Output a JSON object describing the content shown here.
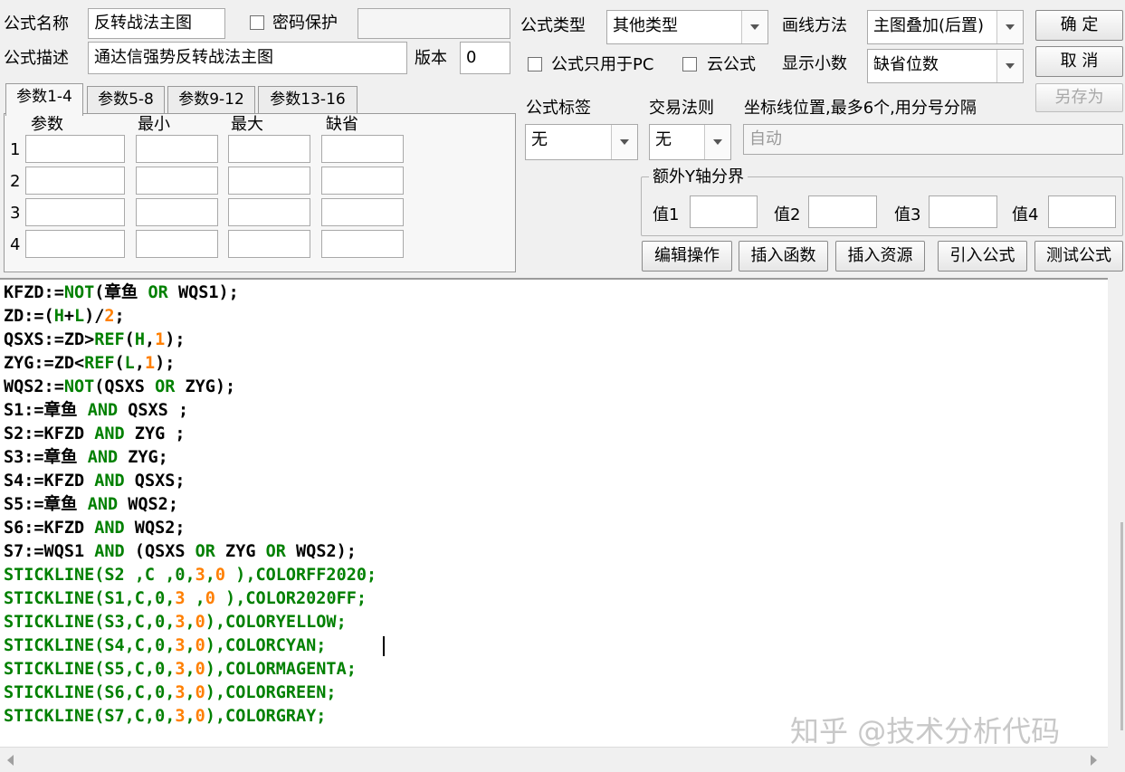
{
  "form": {
    "name_label": "公式名称",
    "name_value": "反转战法主图",
    "password_label": "密码保护",
    "password_value": "",
    "desc_label": "公式描述",
    "desc_value": "通达信强势反转战法主图",
    "version_label": "版本",
    "version_value": "0",
    "type_label": "公式类型",
    "type_value": "其他类型",
    "draw_label": "画线方法",
    "draw_value": "主图叠加(后置)",
    "pc_only_label": "公式只用于PC",
    "cloud_label": "云公式",
    "decimals_label": "显示小数",
    "decimals_value": "缺省位数",
    "tag_label": "公式标签",
    "tag_value": "无",
    "rule_label": "交易法则",
    "rule_value": "无",
    "axis_label": "坐标线位置,最多6个,用分号分隔",
    "axis_value": "自动",
    "y_bound_label": "额外Y轴分界",
    "y_values": [
      "值1",
      "值2",
      "值3",
      "值4"
    ]
  },
  "buttons": {
    "ok": "确  定",
    "cancel": "取  消",
    "save_as": "另存为",
    "edit_ops": "编辑操作",
    "insert_func": "插入函数",
    "insert_res": "插入资源",
    "import_formula": "引入公式",
    "test_formula": "测试公式"
  },
  "params": {
    "tabs": [
      "参数1-4",
      "参数5-8",
      "参数9-12",
      "参数13-16"
    ],
    "headers": [
      "参数",
      "最小",
      "最大",
      "缺省"
    ],
    "rows": [
      "1",
      "2",
      "3",
      "4"
    ]
  },
  "code_lines": [
    [
      [
        "KFZD:=",
        ""
      ],
      [
        "NOT",
        "k"
      ],
      [
        "(章鱼 ",
        ""
      ],
      [
        "OR",
        "k"
      ],
      [
        " WQS1);",
        ""
      ]
    ],
    [
      [
        "ZD:=(",
        ""
      ],
      [
        "H",
        "k"
      ],
      [
        "+",
        ""
      ],
      [
        "L",
        "k"
      ],
      [
        ")/",
        ""
      ],
      [
        "2",
        "n"
      ],
      [
        ";",
        ""
      ]
    ],
    [
      [
        "QSXS:=ZD>",
        ""
      ],
      [
        "REF",
        "k"
      ],
      [
        "(",
        ""
      ],
      [
        "H",
        "k"
      ],
      [
        ",",
        ""
      ],
      [
        "1",
        "n"
      ],
      [
        ");",
        ""
      ]
    ],
    [
      [
        "ZYG:=ZD<",
        ""
      ],
      [
        "REF",
        "k"
      ],
      [
        "(",
        ""
      ],
      [
        "L",
        "k"
      ],
      [
        ",",
        ""
      ],
      [
        "1",
        "n"
      ],
      [
        ");",
        ""
      ]
    ],
    [
      [
        "WQS2:=",
        ""
      ],
      [
        "NOT",
        "k"
      ],
      [
        "(QSXS ",
        ""
      ],
      [
        "OR",
        "k"
      ],
      [
        " ZYG);",
        ""
      ]
    ],
    [
      [
        "S1:=章鱼 ",
        ""
      ],
      [
        "AND",
        "k"
      ],
      [
        " QSXS ;",
        ""
      ]
    ],
    [
      [
        "S2:=KFZD ",
        ""
      ],
      [
        "AND",
        "k"
      ],
      [
        " ZYG ;",
        ""
      ]
    ],
    [
      [
        "S3:=章鱼 ",
        ""
      ],
      [
        "AND",
        "k"
      ],
      [
        " ZYG;",
        ""
      ]
    ],
    [
      [
        "S4:=KFZD ",
        ""
      ],
      [
        "AND",
        "k"
      ],
      [
        " QSXS;",
        ""
      ]
    ],
    [
      [
        "S5:=章鱼 ",
        ""
      ],
      [
        "AND",
        "k"
      ],
      [
        " WQS2;",
        ""
      ]
    ],
    [
      [
        "S6:=KFZD ",
        ""
      ],
      [
        "AND",
        "k"
      ],
      [
        " WQS2;",
        ""
      ]
    ],
    [
      [
        "S7:=WQS1 ",
        ""
      ],
      [
        "AND",
        "k"
      ],
      [
        " (QSXS ",
        ""
      ],
      [
        "OR",
        "k"
      ],
      [
        " ZYG ",
        ""
      ],
      [
        "OR",
        "k"
      ],
      [
        " WQS2);",
        ""
      ]
    ],
    [
      [
        "STICKLINE(S2 ,C ,0,",
        "k"
      ],
      [
        "3",
        "n"
      ],
      [
        ",",
        "k"
      ],
      [
        "0",
        "n"
      ],
      [
        " ),COLORFF2020;",
        "k"
      ]
    ],
    [
      [
        "STICKLINE(S1,C,0,",
        "k"
      ],
      [
        "3",
        "n"
      ],
      [
        " ,",
        "k"
      ],
      [
        "0",
        "n"
      ],
      [
        " ),COLOR2020FF;",
        "k"
      ]
    ],
    [
      [
        "STICKLINE(S3,C,0,",
        "k"
      ],
      [
        "3",
        "n"
      ],
      [
        ",",
        "k"
      ],
      [
        "0",
        "n"
      ],
      [
        "),COLORYELLOW;",
        "k"
      ]
    ],
    [
      [
        "STICKLINE(S4,C,0,",
        "k"
      ],
      [
        "3",
        "n"
      ],
      [
        ",",
        "k"
      ],
      [
        "0",
        "n"
      ],
      [
        "),COLORCYAN;",
        "k"
      ]
    ],
    [
      [
        "STICKLINE(S5,C,0,",
        "k"
      ],
      [
        "3",
        "n"
      ],
      [
        ",",
        "k"
      ],
      [
        "0",
        "n"
      ],
      [
        "),COLORMAGENTA;",
        "k"
      ]
    ],
    [
      [
        "STICKLINE(S6,C,0,",
        "k"
      ],
      [
        "3",
        "n"
      ],
      [
        ",",
        "k"
      ],
      [
        "0",
        "n"
      ],
      [
        "),COLORGREEN;",
        "k"
      ]
    ],
    [
      [
        "STICKLINE(S7,C,0,",
        "k"
      ],
      [
        "3",
        "n"
      ],
      [
        ",",
        "k"
      ],
      [
        "0",
        "n"
      ],
      [
        "),COLORGRAY;",
        "k"
      ]
    ]
  ],
  "watermark": "知乎 @技术分析代码",
  "colors": {
    "keyword": "#008000",
    "number": "#ff7f00",
    "text": "#000000",
    "editor_bg": "#ffffff",
    "dialog_bg": "#f0f0f0"
  }
}
